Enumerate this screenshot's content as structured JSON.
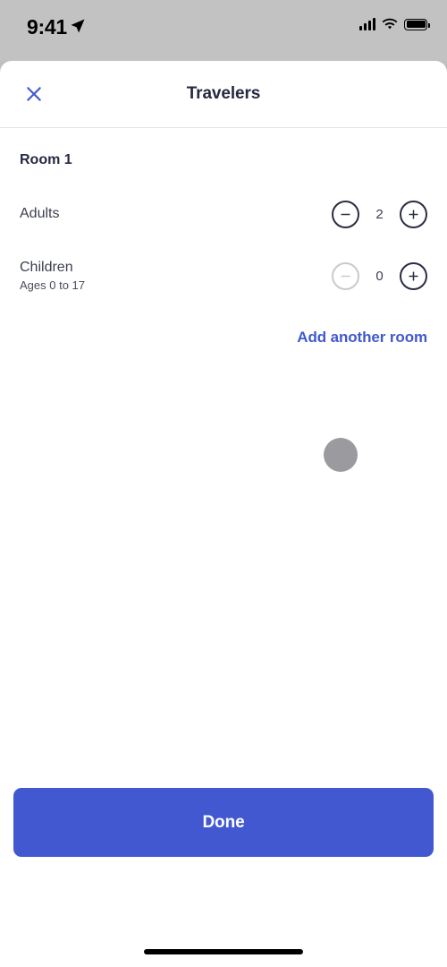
{
  "status_bar": {
    "time": "9:41",
    "location_icon": "location-arrow-icon",
    "signal_icon": "cellular-signal-icon",
    "wifi_icon": "wifi-icon",
    "battery_icon": "battery-full-icon"
  },
  "header": {
    "title": "Travelers",
    "close_icon": "close-x-icon"
  },
  "main": {
    "room_title": "Room 1",
    "counters": [
      {
        "label": "Adults",
        "sublabel": "",
        "value": "2",
        "decrement_icon": "minus-circle-icon",
        "increment_icon": "plus-circle-icon",
        "decrement_disabled": false
      },
      {
        "label": "Children",
        "sublabel": "Ages 0 to 17",
        "value": "0",
        "decrement_icon": "minus-circle-icon",
        "increment_icon": "plus-circle-icon",
        "decrement_disabled": true
      }
    ],
    "add_room_label": "Add another room"
  },
  "footer": {
    "done_label": "Done"
  },
  "colors": {
    "brand_blue": "#4158d0",
    "text_dark": "#262a40",
    "stepper_border": "#2b2d42",
    "stepper_disabled": "#cacace",
    "divider": "#e4e4e8",
    "backdrop_gray": "#c2c2c2",
    "touch_indicator": "#9b9b9f"
  }
}
